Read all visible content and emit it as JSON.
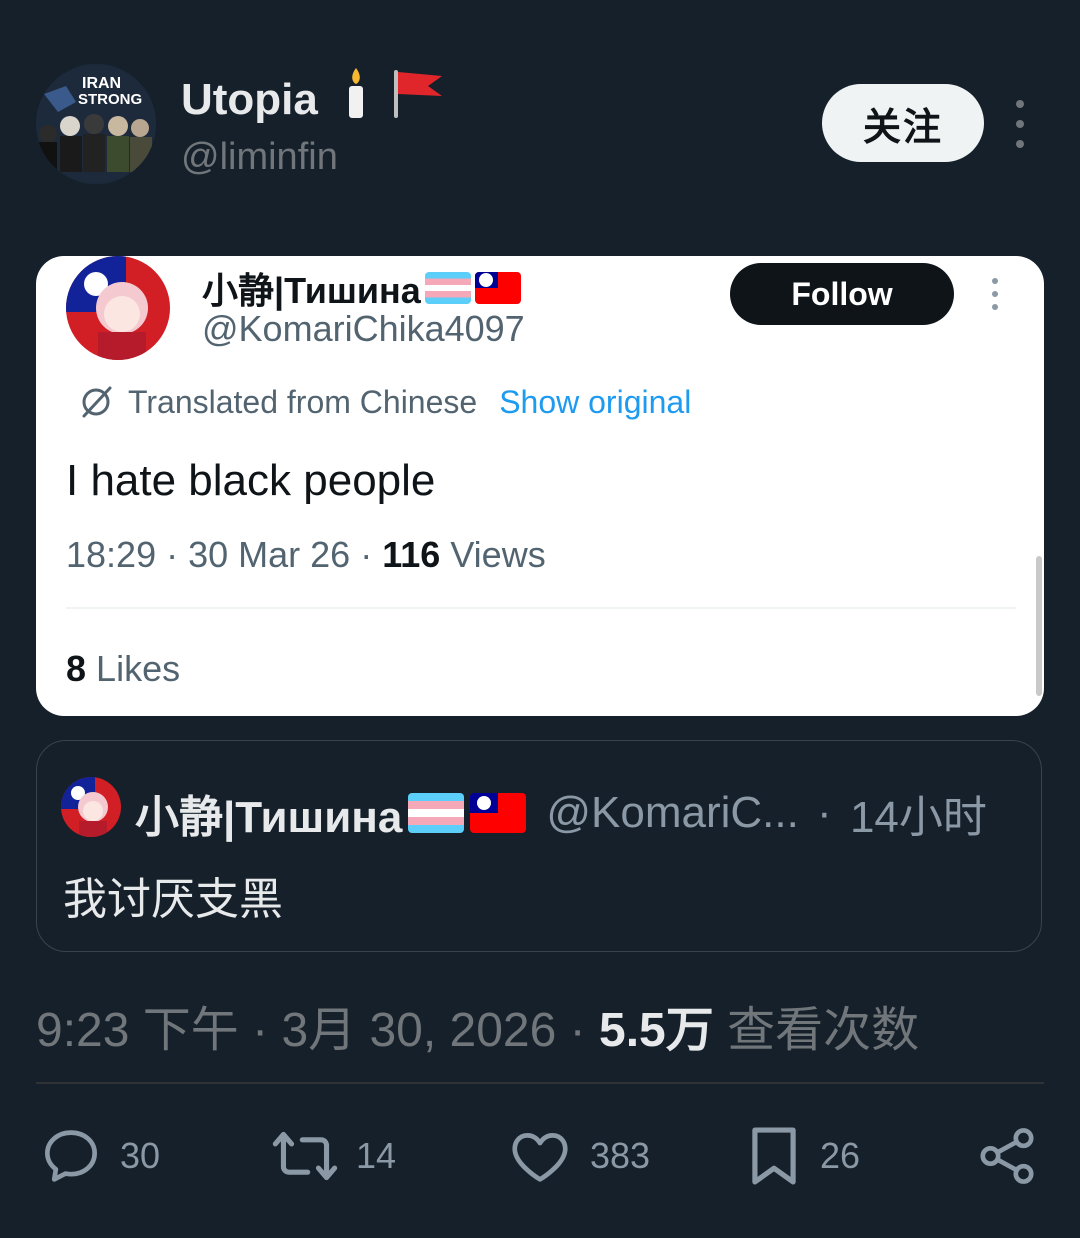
{
  "header": {
    "avatar_text": [
      "IRAN",
      "STRONG"
    ],
    "display_name": "Utopia",
    "name_emoji": [
      "candle",
      "red-flag"
    ],
    "handle": "@liminfin",
    "follow_label": "关注"
  },
  "embedded": {
    "name": "小静|Тишина",
    "name_flags": [
      "transgender-flag",
      "taiwan-flag"
    ],
    "handle": "@KomariChika4097",
    "follow_label": "Follow",
    "translated_label": "Translated from Chinese",
    "show_original_label": "Show original",
    "text": "I hate black people",
    "time": "18:29",
    "date": "30 Mar 26",
    "views_count": "116",
    "views_label": "Views",
    "likes_count": "8",
    "likes_label": "Likes"
  },
  "quote": {
    "name": "小静|Тишина",
    "name_flags": [
      "transgender-flag",
      "taiwan-flag"
    ],
    "handle": "@KomariC...",
    "time": "14小时",
    "text": "我讨厌支黑"
  },
  "post_meta": {
    "time": "9:23 下午",
    "date": "3月 30, 2026",
    "views_count": "5.5万",
    "views_label": "查看次数"
  },
  "actions": {
    "replies": "30",
    "retweets": "14",
    "likes": "383",
    "bookmarks": "26"
  },
  "colors": {
    "background": "#15202b",
    "text_primary": "#e7e9ea",
    "text_secondary": "#71767b",
    "link_blue": "#1d9bf0",
    "card_bg": "#ffffff"
  }
}
